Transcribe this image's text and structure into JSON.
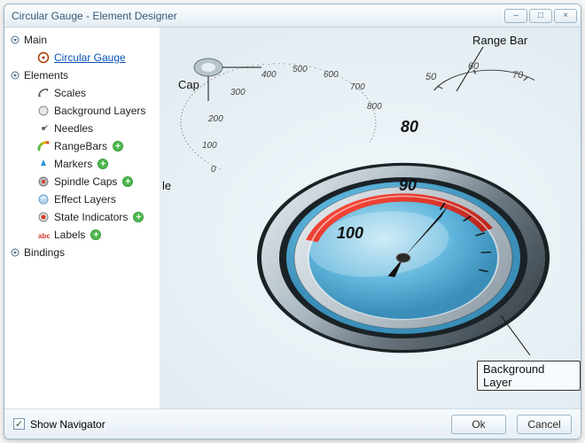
{
  "window": {
    "title": "Circular Gauge - Element Designer"
  },
  "winbtns": {
    "minimize": "–",
    "maximize": "□",
    "close": "×"
  },
  "tree": {
    "main": {
      "label": "Main"
    },
    "circular_gauge": {
      "label": "Circular Gauge"
    },
    "elements": {
      "label": "Elements"
    },
    "scales": {
      "label": "Scales"
    },
    "background_layers": {
      "label": "Background Layers"
    },
    "needles": {
      "label": "Needles"
    },
    "rangebars": {
      "label": "RangeBars"
    },
    "markers": {
      "label": "Markers"
    },
    "spindle_caps": {
      "label": "Spindle Caps"
    },
    "effect_layers": {
      "label": "Effect Layers"
    },
    "state_indicators": {
      "label": "State Indicators"
    },
    "labels": {
      "label": "Labels"
    },
    "bindings": {
      "label": "Bindings"
    }
  },
  "preview": {
    "callouts": {
      "cap": "Cap",
      "range_bar": "Range Bar",
      "le": "le",
      "background_layer": "Background Layer"
    },
    "main_scale": {
      "ticks": [
        "80",
        "90",
        "100"
      ]
    },
    "back_scale": {
      "ticks": [
        "0",
        "100",
        "200",
        "300",
        "400",
        "500",
        "600",
        "700",
        "800"
      ]
    },
    "small_scale": {
      "ticks": [
        "50",
        "60",
        "70"
      ]
    }
  },
  "footer": {
    "show_navigator": "Show Navigator",
    "ok": "Ok",
    "cancel": "Cancel",
    "checked": true
  }
}
